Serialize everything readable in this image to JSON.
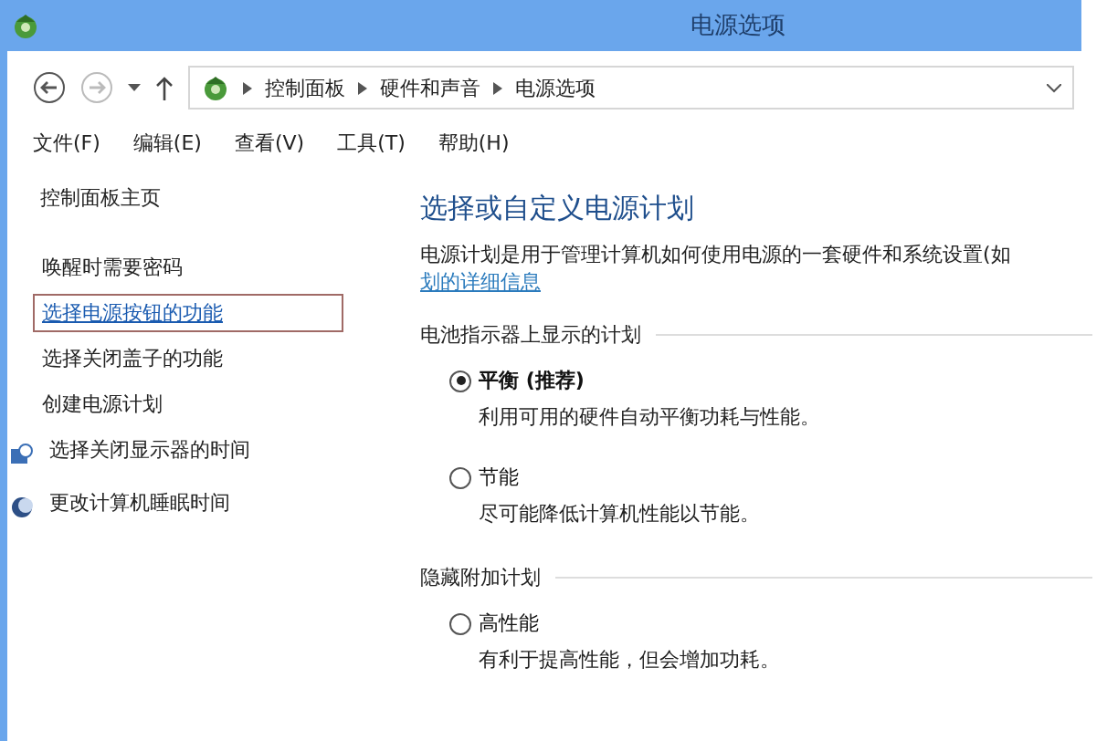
{
  "window": {
    "title": "电源选项"
  },
  "address_bar": {
    "segments": [
      "控制面板",
      "硬件和声音",
      "电源选项"
    ]
  },
  "menu": [
    "文件(F)",
    "编辑(E)",
    "查看(V)",
    "工具(T)",
    "帮助(H)"
  ],
  "sidebar": {
    "home": "控制面板主页",
    "items": [
      {
        "label": "唤醒时需要密码",
        "selected": false,
        "kind": "plain"
      },
      {
        "label": "选择电源按钮的功能",
        "selected": true,
        "kind": "plain"
      },
      {
        "label": "选择关闭盖子的功能",
        "selected": false,
        "kind": "plain"
      },
      {
        "label": "创建电源计划",
        "selected": false,
        "kind": "plain"
      },
      {
        "label": "选择关闭显示器的时间",
        "selected": false,
        "kind": "monitor"
      },
      {
        "label": "更改计算机睡眠时间",
        "selected": false,
        "kind": "moon"
      }
    ]
  },
  "main": {
    "heading": "选择或自定义电源计划",
    "description": "电源计划是用于管理计算机如何使用电源的一套硬件和系统设置(如",
    "link": "划的详细信息",
    "groups": [
      {
        "title": "电池指示器上显示的计划",
        "plans": [
          {
            "name": "平衡 (推荐)",
            "description": "利用可用的硬件自动平衡功耗与性能。",
            "selected": true
          },
          {
            "name": "节能",
            "description": "尽可能降低计算机性能以节能。",
            "selected": false
          }
        ]
      },
      {
        "title": "隐藏附加计划",
        "plans": [
          {
            "name": "高性能",
            "description": "有利于提高性能，但会增加功耗。",
            "selected": false
          }
        ]
      }
    ]
  }
}
